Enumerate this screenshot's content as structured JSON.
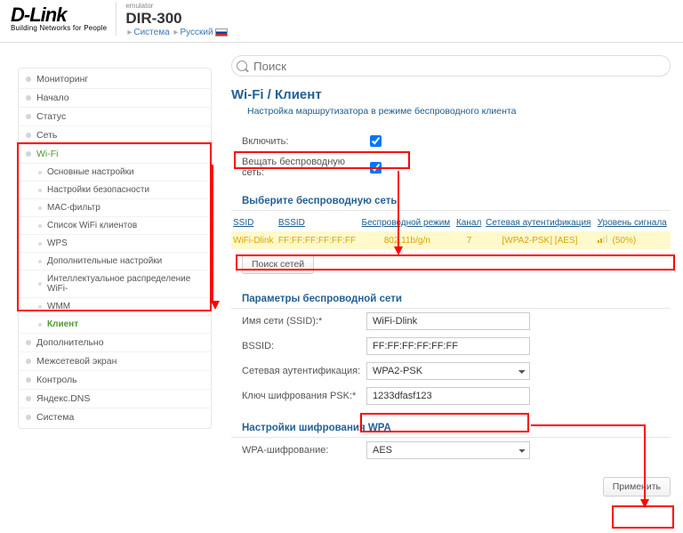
{
  "header": {
    "brand": "D-Link",
    "tagline": "Building Networks for People",
    "emulator": "emulator",
    "model": "DIR-300",
    "trail_a": "Система",
    "trail_b": "Русский"
  },
  "search": {
    "placeholder": "Поиск"
  },
  "sidebar": [
    {
      "label": "Мониторинг",
      "level": 1
    },
    {
      "label": "Начало",
      "level": 1
    },
    {
      "label": "Статус",
      "level": 1
    },
    {
      "label": "Сеть",
      "level": 1
    },
    {
      "label": "Wi-Fi",
      "level": 1,
      "head": true
    },
    {
      "label": "Основные настройки",
      "level": 2
    },
    {
      "label": "Настройки безопасности",
      "level": 2
    },
    {
      "label": "MAC-фильтр",
      "level": 2
    },
    {
      "label": "Список WiFi клиентов",
      "level": 2
    },
    {
      "label": "WPS",
      "level": 2
    },
    {
      "label": "Дополнительные настройки",
      "level": 2
    },
    {
      "label": "Интеллектуальное распределение WiFi-",
      "level": 2
    },
    {
      "label": "WMM",
      "level": 2
    },
    {
      "label": "Клиент",
      "level": 2,
      "active": true
    },
    {
      "label": "Дополнительно",
      "level": 1
    },
    {
      "label": "Межсетевой экран",
      "level": 1
    },
    {
      "label": "Контроль",
      "level": 1
    },
    {
      "label": "Яндекс.DNS",
      "level": 1
    },
    {
      "label": "Система",
      "level": 1
    }
  ],
  "page": {
    "title": "Wi-Fi /  Клиент",
    "desc": "Настройка маршрутизатора в режиме беспроводного клиента",
    "enable_label": "Включить:",
    "broadcast_label": "Вещать беспроводную сеть:",
    "select_net": "Выберите беспроводную сеть",
    "scan_btn": "Поиск сетей",
    "params": "Параметры беспроводной сети",
    "ssid_lbl": "Имя сети (SSID):*",
    "bssid_lbl": "BSSID:",
    "auth_lbl": "Сетевая аутентификация:",
    "psk_lbl": "Ключ шифрования PSK:*",
    "wpa_settings": "Настройки шифрования WPA",
    "wpa_enc_lbl": "WPA-шифрование:",
    "apply": "Применить"
  },
  "table": {
    "headers": {
      "ssid": "SSID",
      "bssid": "BSSID",
      "mode": "Беспроводной режим",
      "channel": "Канал",
      "auth": "Сетевая аутентификация",
      "signal": "Уровень сигнала"
    },
    "row": {
      "ssid": "WiFi-Dlink",
      "bssid": "FF:FF:FF:FF:FF:FF",
      "mode": "802.11b/g/n",
      "channel": "7",
      "auth": "[WPA2-PSK] [AES]",
      "signal": "(50%)"
    }
  },
  "form": {
    "ssid": "WiFi-Dlink",
    "bssid": "FF:FF:FF:FF:FF:FF",
    "auth": "WPA2-PSK",
    "psk": "1233dfasf123",
    "wpa_enc": "AES"
  }
}
